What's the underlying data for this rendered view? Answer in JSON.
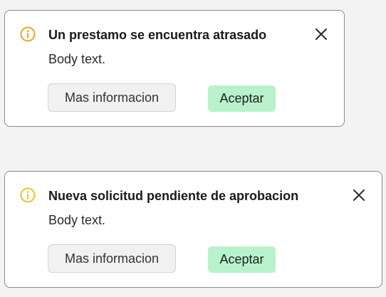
{
  "colors": {
    "background": "#f3f3f3",
    "card_background": "#ffffff",
    "card_border": "#8a8a8a",
    "primary_button": "#b8f2cc",
    "secondary_button": "#f1f1f1"
  },
  "alerts": [
    {
      "icon": "info-circle-icon",
      "icon_color": "#f0a21c",
      "title": "Un prestamo se encuentra atrasado",
      "body": "Body text.",
      "secondary_button_label": "Mas informacion",
      "primary_button_label": "Aceptar",
      "close_icon": "close-icon"
    },
    {
      "icon": "info-circle-icon",
      "icon_color": "#f2c21a",
      "title": "Nueva solicitud pendiente de aprobacion",
      "body": "Body text.",
      "secondary_button_label": "Mas informacion",
      "primary_button_label": "Aceptar",
      "close_icon": "close-icon"
    }
  ]
}
